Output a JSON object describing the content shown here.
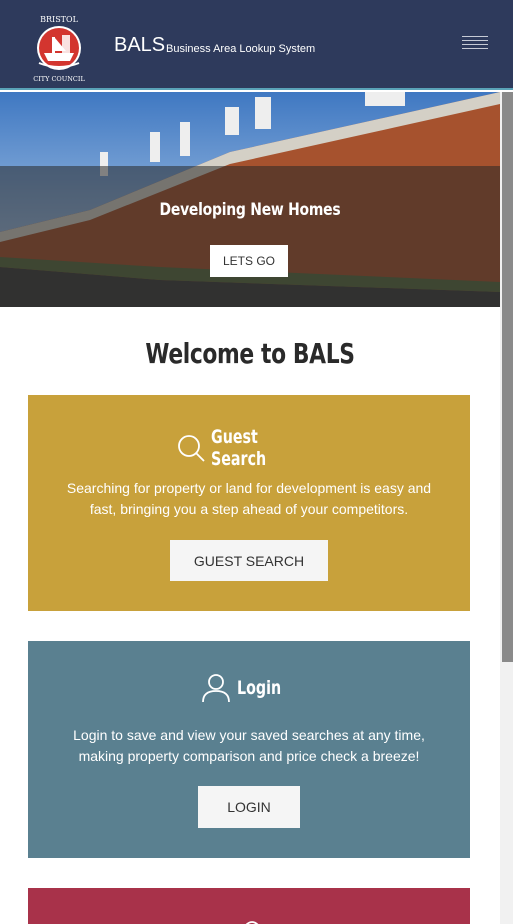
{
  "header": {
    "logo_text_top": "BRISTOL",
    "logo_text_bottom": "CITY COUNCIL",
    "app_name": "BALS",
    "app_subtitle": "Business Area Lookup System",
    "menu_icon": "hamburger-icon"
  },
  "hero": {
    "title": "Developing New Homes",
    "button_label": "LETS GO"
  },
  "welcome": {
    "heading": "Welcome to BALS"
  },
  "cards": [
    {
      "icon": "search-icon",
      "title": "Guest Search",
      "text": "Searching for property or land for development is easy and fast, bringing you a step ahead of your competitors.",
      "button_label": "GUEST SEARCH",
      "color": "#c8a13b"
    },
    {
      "icon": "user-icon",
      "title": "Login",
      "text": "Login to save and view your saved searches at any time, making property comparison and price check a breeze!",
      "button_label": "LOGIN",
      "color": "#5a8090"
    },
    {
      "color": "#a8324a"
    }
  ],
  "colors": {
    "header_bg": "#2e3a5c",
    "accent_line": "#5aa3b8"
  }
}
